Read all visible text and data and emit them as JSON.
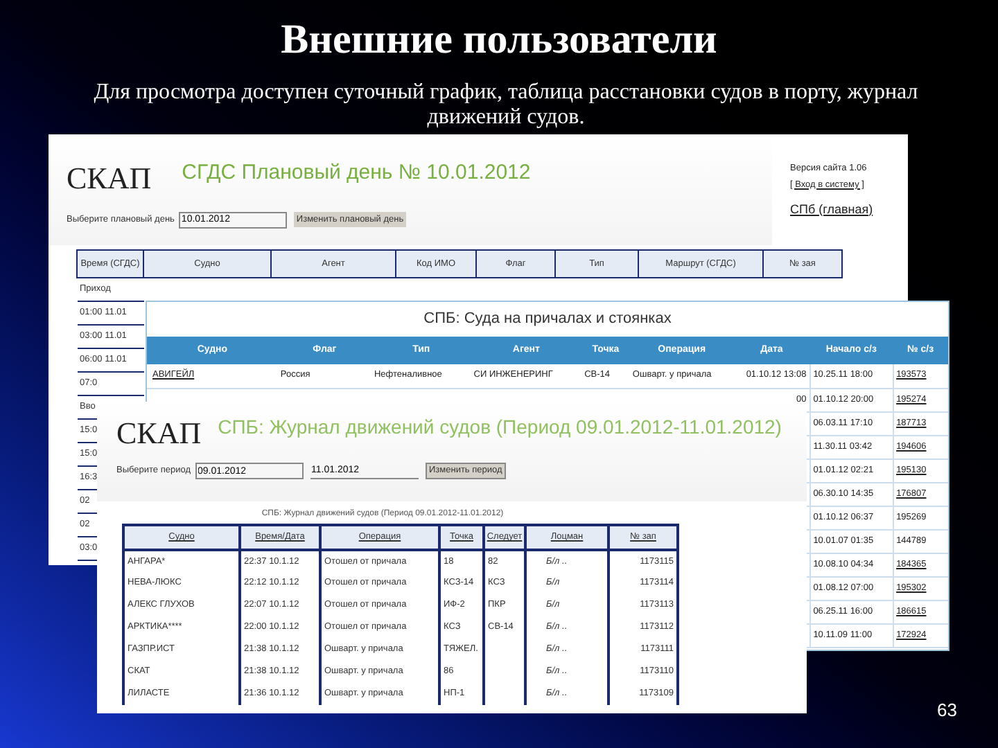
{
  "slide": {
    "title": "Внешние пользователи",
    "subtitle": "Для просмотра доступен суточный график, таблица расстановки судов в порту, журнал движений судов.",
    "page_number": "63"
  },
  "plan_window": {
    "logo": "СКАП",
    "title": "СГДС Плановый день № 10.01.2012",
    "version": "Версия сайта 1.06",
    "login_link": "[ Вход в систему ]",
    "home_link": "СПб (главная)",
    "day_label": "Выберите плановый день",
    "day_value": "10.01.2012",
    "change_button": "Изменить плановый день",
    "columns": [
      "Время (СГДС)",
      "Судно",
      "Агент",
      "Код ИМО",
      "Флаг",
      "Тип",
      "Маршрут (СГДС)",
      "№ зая"
    ],
    "rows": [
      "Приход",
      "01:00 11.01",
      "03:00 11.01",
      "06:00 11.01",
      "07:0",
      "Вво",
      "15:0",
      "15:0",
      "16:3",
      "02",
      "02",
      "03:0"
    ]
  },
  "berths_window": {
    "title": "СПБ: Суда на причалах и стоянках",
    "columns": [
      "Судно",
      "Флаг",
      "Тип",
      "Агент",
      "Точка",
      "Операция",
      "Дата",
      "Начало с/з",
      "№ с/з"
    ],
    "rows": [
      {
        "vessel": "АВИГЕЙЛ",
        "flag": "Россия",
        "type": "Нефтеналивное",
        "agent": "СИ ИНЖЕНЕРИНГ",
        "point": "СВ-14",
        "operation": "Ошварт. у причала",
        "date": "01.10.12 13:08",
        "start": "10.25.11 18:00",
        "number": "193573",
        "number_link": true
      },
      {
        "date": "00",
        "start": "01.10.12 20:00",
        "number": "195274",
        "number_link": true
      },
      {
        "start": "06.03.11 17:10",
        "number": "187713",
        "number_link": true
      },
      {
        "start": "11.30.11 03:42",
        "number": "194606",
        "number_link": true
      },
      {
        "start": "01.01.12 02:21",
        "number": "195130",
        "number_link": true
      },
      {
        "start": "06.30.10 14:35",
        "number": "176807",
        "number_link": true
      },
      {
        "start": "01.10.12 06:37",
        "number": "195269",
        "number_link": false
      },
      {
        "start": "10.01.07 01:35",
        "number": "144789",
        "number_link": false
      },
      {
        "start": "10.08.10 04:34",
        "number": "184365",
        "number_link": true
      },
      {
        "start": "01.08.12 07:00",
        "number": "195302",
        "number_link": true
      },
      {
        "start": "06.25.11 16:00",
        "number": "186615",
        "number_link": true
      },
      {
        "start": "10.11.09 11:00",
        "number": "172924",
        "number_link": true
      }
    ]
  },
  "journal_window": {
    "logo": "СКАП",
    "title": "СПБ: Журнал движений судов (Период 09.01.2012-11.01.2012)",
    "period_label": "Выберите период",
    "from": "09.01.2012",
    "to": "11.01.2012",
    "change_button": "Изменить период",
    "caption": "СПБ: Журнал движений судов (Период 09.01.2012-11.01.2012)",
    "columns": [
      "Судно",
      "Время/Дата",
      "Операция",
      "Точка",
      "Следует",
      "Лоцман",
      "№ зап"
    ],
    "rows": [
      [
        "АНГАРА*",
        "22:37 10.1.12",
        "Отошел от причала",
        "18",
        "82",
        "Б/л ..",
        "1173115"
      ],
      [
        "НЕВА-ЛЮКС",
        "22:12 10.1.12",
        "Отошел от причала",
        "КСЗ-14",
        "КСЗ",
        "Б/л",
        "1173114"
      ],
      [
        "АЛЕКС ГЛУХОВ",
        "22:07 10.1.12",
        "Отошел от причала",
        "ИФ-2",
        "ПКР",
        "Б/л",
        "1173113"
      ],
      [
        "АРКТИКА****",
        "22:00 10.1.12",
        "Отошел от причала",
        "КСЗ",
        "СВ-14",
        "Б/л ..",
        "1173112"
      ],
      [
        "ГАЗПР.ИСТ",
        "21:38 10.1.12",
        "Ошварт. у причала",
        "ТЯЖЕЛ.",
        "",
        "Б/л ..",
        "1173111"
      ],
      [
        "СКАТ",
        "21:38 10.1.12",
        "Ошварт. у причала",
        "86",
        "",
        "Б/л ..",
        "1173110"
      ],
      [
        "ЛИЛАСТЕ",
        "21:36 10.1.12",
        "Ошварт. у причала",
        "НП-1",
        "",
        "Б/л ..",
        "1173109"
      ]
    ]
  }
}
